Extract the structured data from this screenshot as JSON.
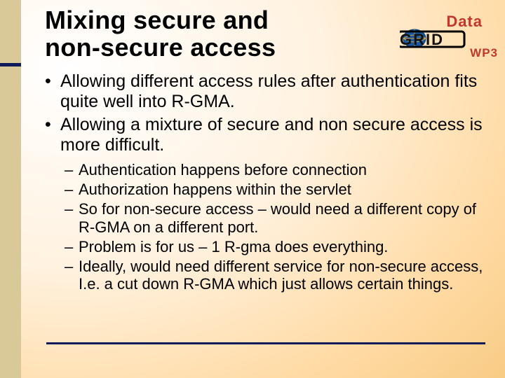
{
  "title_line1": "Mixing secure and",
  "title_line2": "non-secure access",
  "logo": {
    "data_text": "Data",
    "grid_text": "GRID",
    "wp3": "WP3"
  },
  "bullets": [
    "Allowing different access rules after authentication fits quite well into R-GMA.",
    "Allowing a mixture of secure and non secure access is more difficult."
  ],
  "sub_bullets": [
    "Authentication happens before connection",
    "Authorization happens within the servlet",
    "So for non-secure access – would need a different copy of R-GMA on a different port.",
    "Problem is for us – 1 R-gma does everything.",
    "Ideally, would need different service for non-secure access, I.e. a cut down R-GMA which just allows certain things."
  ],
  "colors": {
    "accent_blue": "#0f1a5a",
    "accent_red": "#c0392b"
  }
}
